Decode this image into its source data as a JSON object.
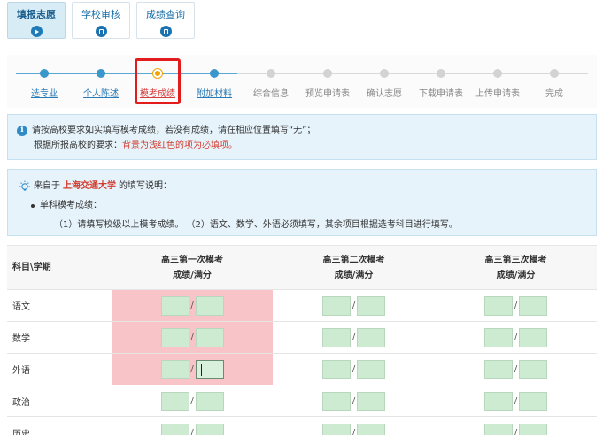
{
  "top_tabs": [
    {
      "label": "填报志愿",
      "icon": "play-icon",
      "active": true
    },
    {
      "label": "学校审核",
      "icon": "document-icon",
      "active": false
    },
    {
      "label": "成绩查询",
      "icon": "document-icon",
      "active": false
    }
  ],
  "steps": [
    {
      "label": "选专业",
      "state": "done"
    },
    {
      "label": "个人陈述",
      "state": "done"
    },
    {
      "label": "模考成绩",
      "state": "current"
    },
    {
      "label": "附加材料",
      "state": "done"
    },
    {
      "label": "综合信息",
      "state": "pending"
    },
    {
      "label": "预览申请表",
      "state": "pending"
    },
    {
      "label": "确认志愿",
      "state": "pending"
    },
    {
      "label": "下载申请表",
      "state": "pending"
    },
    {
      "label": "上传申请表",
      "state": "pending"
    },
    {
      "label": "完成",
      "state": "pending"
    }
  ],
  "info": {
    "line1": "请按高校要求如实填写模考成绩，若没有成绩，请在相应位置填写“无”；",
    "line2_prefix": "根据所报高校的要求：",
    "line2_highlight": "背景为浅红色的项为必填项。"
  },
  "note": {
    "prefix": "来自于",
    "school": "上海交通大学",
    "suffix": "的填写说明：",
    "bullet": "单科模考成绩：",
    "detail": "（1）请填写校级以上模考成绩。 （2）语文、数学、外语必须填写，其余项目根据选考科目进行填写。"
  },
  "table": {
    "corner": "科目\\学期",
    "columns": [
      {
        "line1": "高三第一次模考",
        "line2": "成绩/满分"
      },
      {
        "line1": "高三第二次模考",
        "line2": "成绩/满分"
      },
      {
        "line1": "高三第三次模考",
        "line2": "成绩/满分"
      }
    ],
    "separator": "/",
    "rows": [
      {
        "subject": "语文",
        "required": true
      },
      {
        "subject": "数学",
        "required": true
      },
      {
        "subject": "外语",
        "required": true
      },
      {
        "subject": "政治",
        "required": false
      },
      {
        "subject": "历史",
        "required": false
      }
    ]
  },
  "colors": {
    "accent": "#1a72b0",
    "current_step": "#f2a300",
    "required_bg": "#f9c4c7",
    "input_bg": "#ccebd1",
    "highlight_border": "#e31b1b"
  }
}
